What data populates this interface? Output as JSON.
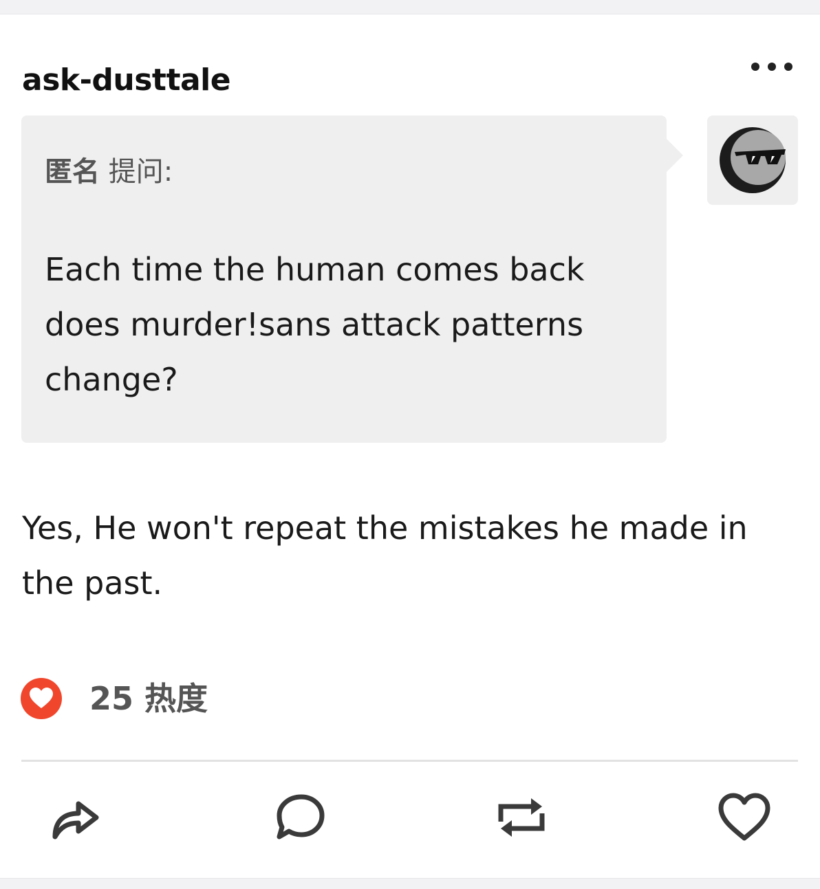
{
  "post": {
    "blog_name": "ask-dusttale",
    "more_menu_icon": "ellipsis-icon",
    "ask": {
      "asker_label_bold": "匿名",
      "asker_label_rest": " 提问:",
      "question": "Each time the human comes back does murder!sans attack patterns change?",
      "avatar_icon": "anonymous-sunglasses-avatar"
    },
    "answer": "Yes, He won't repeat the mistakes he made in the past.",
    "notes": {
      "count_label": "25 热度",
      "icon": "heart-icon",
      "icon_color": "#f0462c"
    },
    "actions": [
      {
        "name": "share",
        "icon": "share-arrow-icon"
      },
      {
        "name": "reply",
        "icon": "speech-bubble-icon"
      },
      {
        "name": "reblog",
        "icon": "reblog-icon"
      },
      {
        "name": "like",
        "icon": "heart-outline-icon"
      }
    ]
  },
  "colors": {
    "bubble_bg": "#efefef",
    "text": "#1a1a1a",
    "muted_text": "#555555",
    "accent_red": "#f0462c"
  }
}
